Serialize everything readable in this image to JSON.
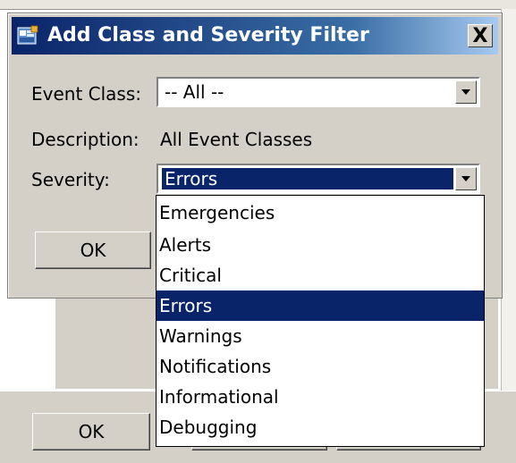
{
  "dialog": {
    "title": "Add Class and Severity Filter",
    "close_label": "X",
    "event_class": {
      "label": "Event Class:",
      "value": "-- All --"
    },
    "description": {
      "label": "Description:",
      "value": "All Event Classes"
    },
    "severity": {
      "label": "Severity:",
      "value": "Errors",
      "options": [
        "Emergencies",
        "Alerts",
        "Critical",
        "Errors",
        "Warnings",
        "Notifications",
        "Informational",
        "Debugging"
      ],
      "selected_index": 3
    },
    "ok_label": "OK"
  },
  "background_window": {
    "ok_label": "OK"
  },
  "colors": {
    "face": "#d4d0c8",
    "selection": "#0a246a",
    "title_start": "#0a246a",
    "title_end": "#a6caf0"
  }
}
